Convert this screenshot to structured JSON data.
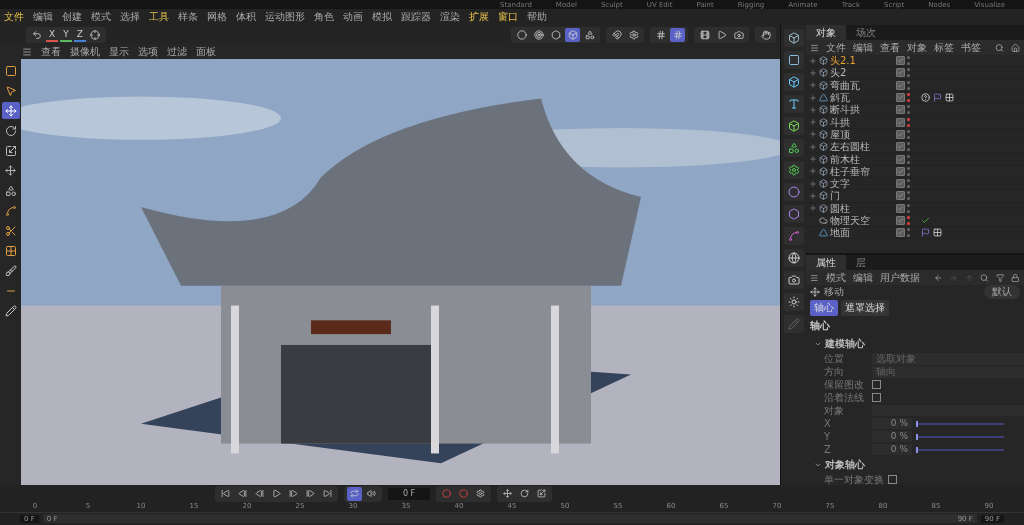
{
  "layout_tabs": [
    "Standard",
    "Model",
    "Sculpt",
    "UV Edit",
    "Paint",
    "Rigging",
    "Animate",
    "Track",
    "Script",
    "Nodes",
    "Visualize"
  ],
  "menu": [
    {
      "label": "文件",
      "accent": true
    },
    {
      "label": "编辑",
      "accent": false
    },
    {
      "label": "创建",
      "accent": false
    },
    {
      "label": "模式",
      "accent": false
    },
    {
      "label": "选择",
      "accent": false
    },
    {
      "label": "工具",
      "accent": true
    },
    {
      "label": "样条",
      "accent": false
    },
    {
      "label": "网格",
      "accent": false
    },
    {
      "label": "体积",
      "accent": false
    },
    {
      "label": "运动图形",
      "accent": false
    },
    {
      "label": "角色",
      "accent": false
    },
    {
      "label": "动画",
      "accent": false
    },
    {
      "label": "模拟",
      "accent": false
    },
    {
      "label": "跟踪器",
      "accent": false
    },
    {
      "label": "渲染",
      "accent": false
    },
    {
      "label": "扩展",
      "accent": true
    },
    {
      "label": "窗口",
      "accent": true
    },
    {
      "label": "帮助",
      "accent": false
    }
  ],
  "axes": [
    {
      "label": "X",
      "color": "#d9534f"
    },
    {
      "label": "Y",
      "color": "#5cb85c"
    },
    {
      "label": "Z",
      "color": "#4a7fd6"
    }
  ],
  "mode_tools": [
    {
      "selected": false
    },
    {
      "selected": false
    },
    {
      "selected": false
    },
    {
      "selected": true
    },
    {
      "selected": false
    }
  ],
  "snap_tools": [
    {
      "selected": false
    },
    {
      "selected": true
    }
  ],
  "viewport": {
    "menu": [
      "查看",
      "摄像机",
      "显示",
      "选项",
      "过滤",
      "面板"
    ]
  },
  "left_tools": [
    {
      "kind": "select",
      "selected": false
    },
    {
      "kind": "live",
      "selected": false
    },
    {
      "kind": "move",
      "selected": true
    },
    {
      "kind": "rotate",
      "selected": false
    },
    {
      "kind": "scale",
      "selected": false
    },
    {
      "kind": "transform",
      "selected": false
    },
    {
      "kind": "points",
      "selected": false
    },
    {
      "kind": "arc",
      "selected": false
    },
    {
      "kind": "knife",
      "selected": false
    },
    {
      "kind": "paint",
      "selected": false
    },
    {
      "kind": "brush",
      "selected": false
    },
    {
      "kind": "line",
      "selected": false
    },
    {
      "kind": "spline",
      "selected": false
    }
  ],
  "objects": {
    "tabs": [
      {
        "label": "对象",
        "selected": true
      },
      {
        "label": "场次",
        "selected": false
      }
    ],
    "menu": [
      "文件",
      "编辑",
      "查看",
      "对象",
      "标签",
      "书签"
    ],
    "items": [
      {
        "name": "头2.1",
        "kind": "null",
        "selected": true,
        "expandable": true,
        "checked": true,
        "hidden": false
      },
      {
        "name": "头2",
        "kind": "null",
        "selected": false,
        "expandable": true,
        "checked": true,
        "hidden": false
      },
      {
        "name": "弯曲瓦",
        "kind": "null",
        "selected": false,
        "expandable": true,
        "checked": true,
        "hidden": false
      },
      {
        "name": "斜瓦",
        "kind": "poly",
        "selected": false,
        "expandable": true,
        "checked": true,
        "hidden": true,
        "tags": [
          {
            "kind": "unknown"
          },
          {
            "kind": "material"
          },
          {
            "kind": "checker"
          }
        ]
      },
      {
        "name": "断斗拱",
        "kind": "null",
        "selected": false,
        "expandable": true,
        "checked": true,
        "hidden": false
      },
      {
        "name": "斗拱",
        "kind": "null",
        "selected": false,
        "expandable": true,
        "checked": true,
        "hidden": true
      },
      {
        "name": "屋顶",
        "kind": "null",
        "selected": false,
        "expandable": true,
        "checked": true,
        "hidden": false
      },
      {
        "name": "左右圆柱",
        "kind": "null",
        "selected": false,
        "expandable": true,
        "checked": true,
        "hidden": false
      },
      {
        "name": "前木柱",
        "kind": "null",
        "selected": false,
        "expandable": true,
        "checked": true,
        "hidden": false
      },
      {
        "name": "柱子垂帘",
        "kind": "null",
        "selected": false,
        "expandable": true,
        "checked": true,
        "hidden": false
      },
      {
        "name": "文字",
        "kind": "null",
        "selected": false,
        "expandable": true,
        "checked": true,
        "hidden": false
      },
      {
        "name": "门",
        "kind": "null",
        "selected": false,
        "expandable": true,
        "checked": true,
        "hidden": false
      },
      {
        "name": "圆柱",
        "kind": "null",
        "selected": false,
        "expandable": true,
        "checked": true,
        "hidden": false
      },
      {
        "name": "物理天空",
        "kind": "sky",
        "selected": false,
        "expandable": false,
        "checked": true,
        "hidden": true,
        "tags": [
          {
            "kind": "check"
          }
        ]
      },
      {
        "name": "地面",
        "kind": "poly",
        "selected": false,
        "expandable": false,
        "checked": true,
        "hidden": false,
        "tags": [
          {
            "kind": "material"
          },
          {
            "kind": "checker"
          }
        ]
      }
    ]
  },
  "attributes": {
    "tabs": [
      {
        "label": "属性",
        "selected": true
      },
      {
        "label": "层",
        "selected": false
      }
    ],
    "menu": [
      "模式",
      "编辑",
      "用户数据"
    ],
    "tool": "移动",
    "preset": "默认",
    "sub_tabs": [
      {
        "label": "轴心",
        "selected": true
      },
      {
        "label": "遮罩选择",
        "selected": false
      }
    ],
    "section": "轴心",
    "groups": [
      {
        "title": "建模轴心",
        "fields": [
          {
            "kind": "dropdown",
            "label": "位置",
            "value": "选取对象"
          },
          {
            "kind": "dropdown",
            "label": "方向",
            "value": "轴向"
          },
          {
            "kind": "checkbox",
            "label": "保留图改",
            "checked": false
          },
          {
            "kind": "checkbox",
            "label": "沿着法线",
            "checked": false
          },
          {
            "kind": "link",
            "label": "对象"
          },
          {
            "kind": "slider",
            "label": "X",
            "value": "0 %",
            "level": 0
          },
          {
            "kind": "slider",
            "label": "Y",
            "value": "0 %",
            "level": 0
          },
          {
            "kind": "slider",
            "label": "Z",
            "value": "0 %",
            "level": 0
          }
        ]
      },
      {
        "title": "对象轴心",
        "fields": [
          {
            "kind": "checkbox",
            "label": "单一对象变换",
            "checked": false
          }
        ]
      }
    ]
  },
  "timeline": {
    "loop_on": true,
    "frame": "0 F",
    "ruler": [
      "0",
      "5",
      "10",
      "15",
      "20",
      "25",
      "30",
      "35",
      "40",
      "45",
      "50",
      "55",
      "60",
      "65",
      "70",
      "75",
      "80",
      "85",
      "90"
    ],
    "range_start": "0 F",
    "range_min": "0 F",
    "range_max": "90 F",
    "range_end": "90 F"
  }
}
